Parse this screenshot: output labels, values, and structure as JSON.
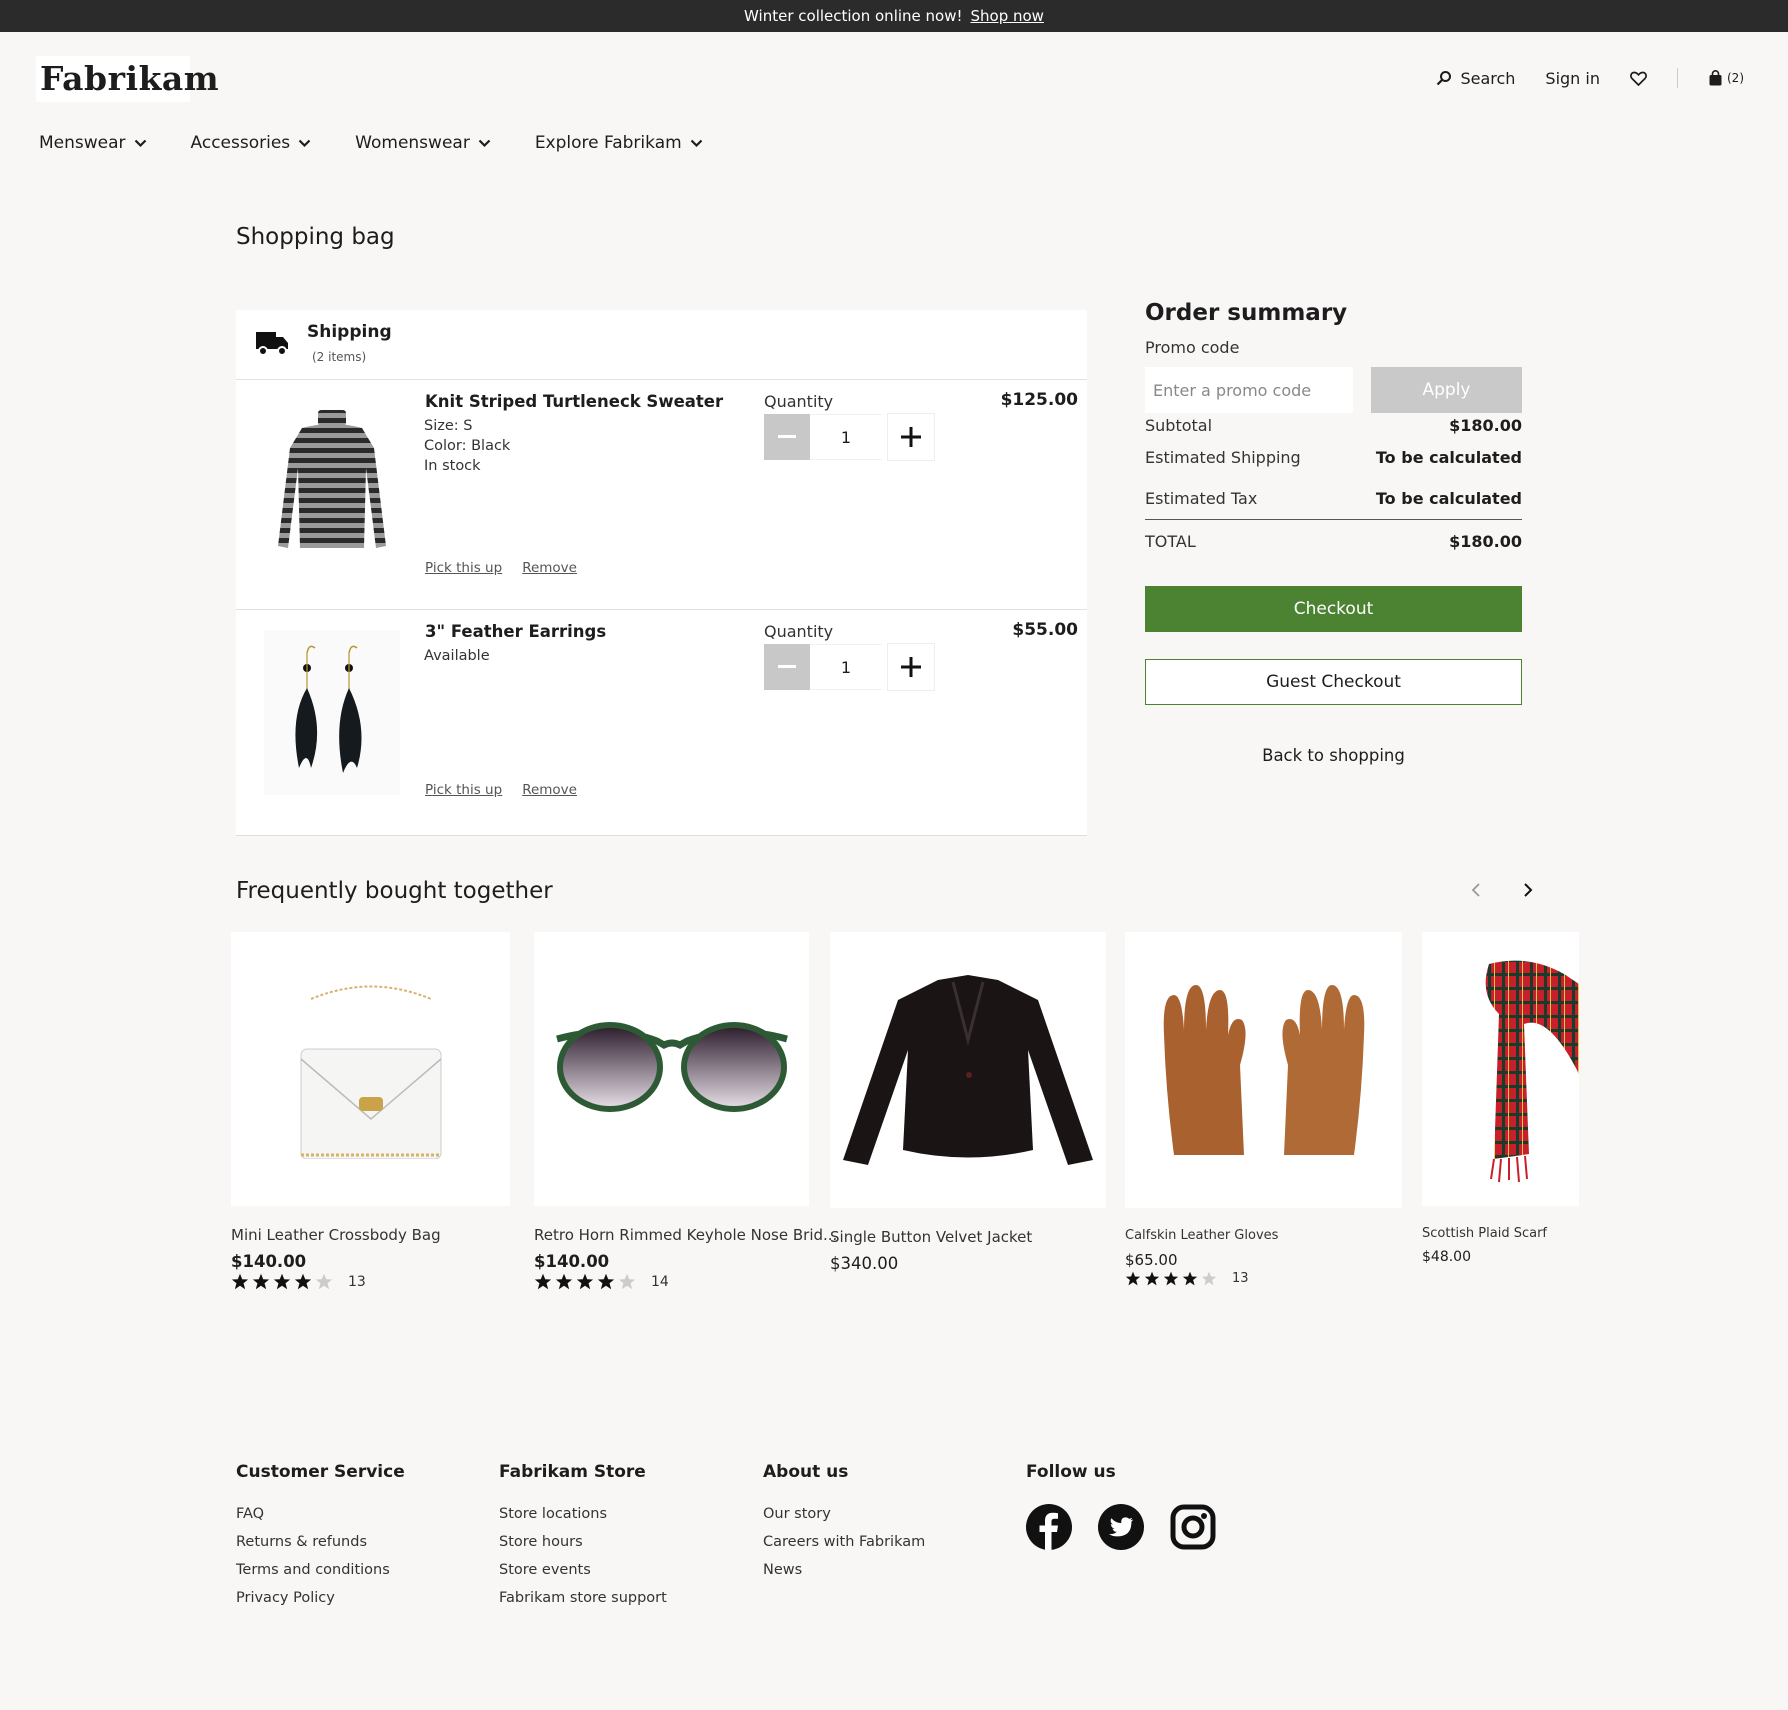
{
  "banner": {
    "text": "Winter collection online now!",
    "link": "Shop now"
  },
  "header": {
    "logo": "Fabrikam",
    "search": "Search",
    "signin": "Sign in",
    "cart_count": "(2)"
  },
  "nav": [
    "Menswear",
    "Accessories",
    "Womenswear",
    "Explore Fabrikam"
  ],
  "page_title": "Shopping bag",
  "bag": {
    "heading": "Shipping",
    "subheading": "(2 items)",
    "qty_label": "Quantity",
    "pickup_label": "Pick this up",
    "remove_label": "Remove",
    "items": [
      {
        "name": "Knit Striped Turtleneck Sweater",
        "details": [
          "Size: S",
          "Color: Black",
          "In stock"
        ],
        "quantity": "1",
        "price": "$125.00"
      },
      {
        "name": "3\" Feather Earrings",
        "details": [
          "Available"
        ],
        "quantity": "1",
        "price": "$55.00"
      }
    ]
  },
  "summary": {
    "title": "Order summary",
    "promo_label": "Promo code",
    "promo_placeholder": "Enter a promo code",
    "apply": "Apply",
    "subtotal_label": "Subtotal",
    "subtotal": "$180.00",
    "shipping_label": "Estimated Shipping",
    "shipping": "To be calculated",
    "tax_label": "Estimated Tax",
    "tax": "To be calculated",
    "total_label": "TOTAL",
    "total": "$180.00",
    "checkout": "Checkout",
    "guest_checkout": "Guest Checkout",
    "back": "Back to shopping"
  },
  "fbt": {
    "title": "Frequently bought together",
    "products": [
      {
        "name": "Mini Leather Crossbody Bag",
        "price": "$140.00",
        "rating": 4,
        "reviews": "13"
      },
      {
        "name": "Retro Horn Rimmed Keyhole Nose Brid...",
        "price": "$140.00",
        "rating": 4,
        "reviews": "14"
      },
      {
        "name": "Single Button Velvet Jacket",
        "price": "$340.00"
      },
      {
        "name": "Calfskin Leather Gloves",
        "price": "$65.00",
        "rating": 4,
        "reviews": "13"
      },
      {
        "name": "Scottish Plaid Scarf",
        "price": "$48.00"
      }
    ]
  },
  "footer": {
    "customer_service": {
      "title": "Customer Service",
      "links": [
        "FAQ",
        "Returns & refunds",
        "Terms and conditions",
        "Privacy Policy"
      ]
    },
    "store": {
      "title": "Fabrikam Store",
      "links": [
        "Store locations",
        "Store hours",
        "Store events",
        "Fabrikam store support"
      ]
    },
    "about": {
      "title": "About us",
      "links": [
        "Our story",
        "Careers with Fabrikam",
        "News"
      ]
    },
    "follow": {
      "title": "Follow us"
    }
  },
  "colors": {
    "accent": "#4b8333",
    "banner": "#2b2b2b",
    "background": "#f8f7f6"
  },
  "icons": [
    "search-icon",
    "heart-icon",
    "bag-icon",
    "chevron-down-icon",
    "truck-icon",
    "minus-icon",
    "plus-icon",
    "chevron-left-icon",
    "chevron-right-icon",
    "star-icon",
    "facebook-icon",
    "twitter-icon",
    "instagram-icon"
  ]
}
